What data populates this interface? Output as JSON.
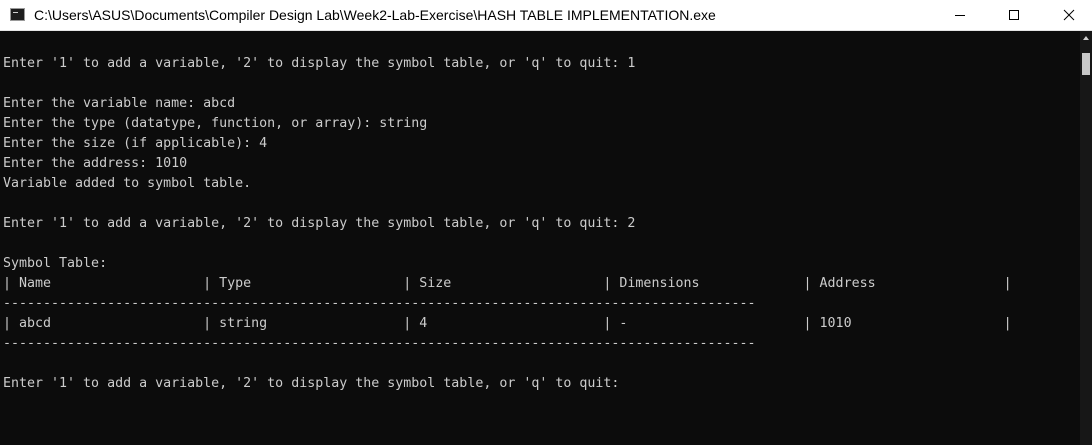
{
  "window": {
    "title": "C:\\Users\\ASUS\\Documents\\Compiler Design Lab\\Week2-Lab-Exercise\\HASH TABLE IMPLEMENTATION.exe",
    "icon": "console-app-icon",
    "controls": [
      "minimize-icon",
      "maximize-icon",
      "close-icon"
    ]
  },
  "console": {
    "colors": {
      "background": "#0c0c0c",
      "text": "#cccccc"
    },
    "lines": [
      "Enter '1' to add a variable, '2' to display the symbol table, or 'q' to quit: 1",
      "",
      "Enter the variable name: abcd",
      "Enter the type (datatype, function, or array): string",
      "Enter the size (if applicable): 4",
      "Enter the address: 1010",
      "Variable added to symbol table.",
      "",
      "Enter '1' to add a variable, '2' to display the symbol table, or 'q' to quit: 2",
      "",
      "Symbol Table:",
      "| Name                   | Type                   | Size                   | Dimensions             | Address                |",
      "----------------------------------------------------------------------------------------------",
      "| abcd                   | string                 | 4                      | -                      | 1010                   |",
      "----------------------------------------------------------------------------------------------",
      "",
      "",
      "Enter '1' to add a variable, '2' to display the symbol table, or 'q' to quit: "
    ]
  }
}
